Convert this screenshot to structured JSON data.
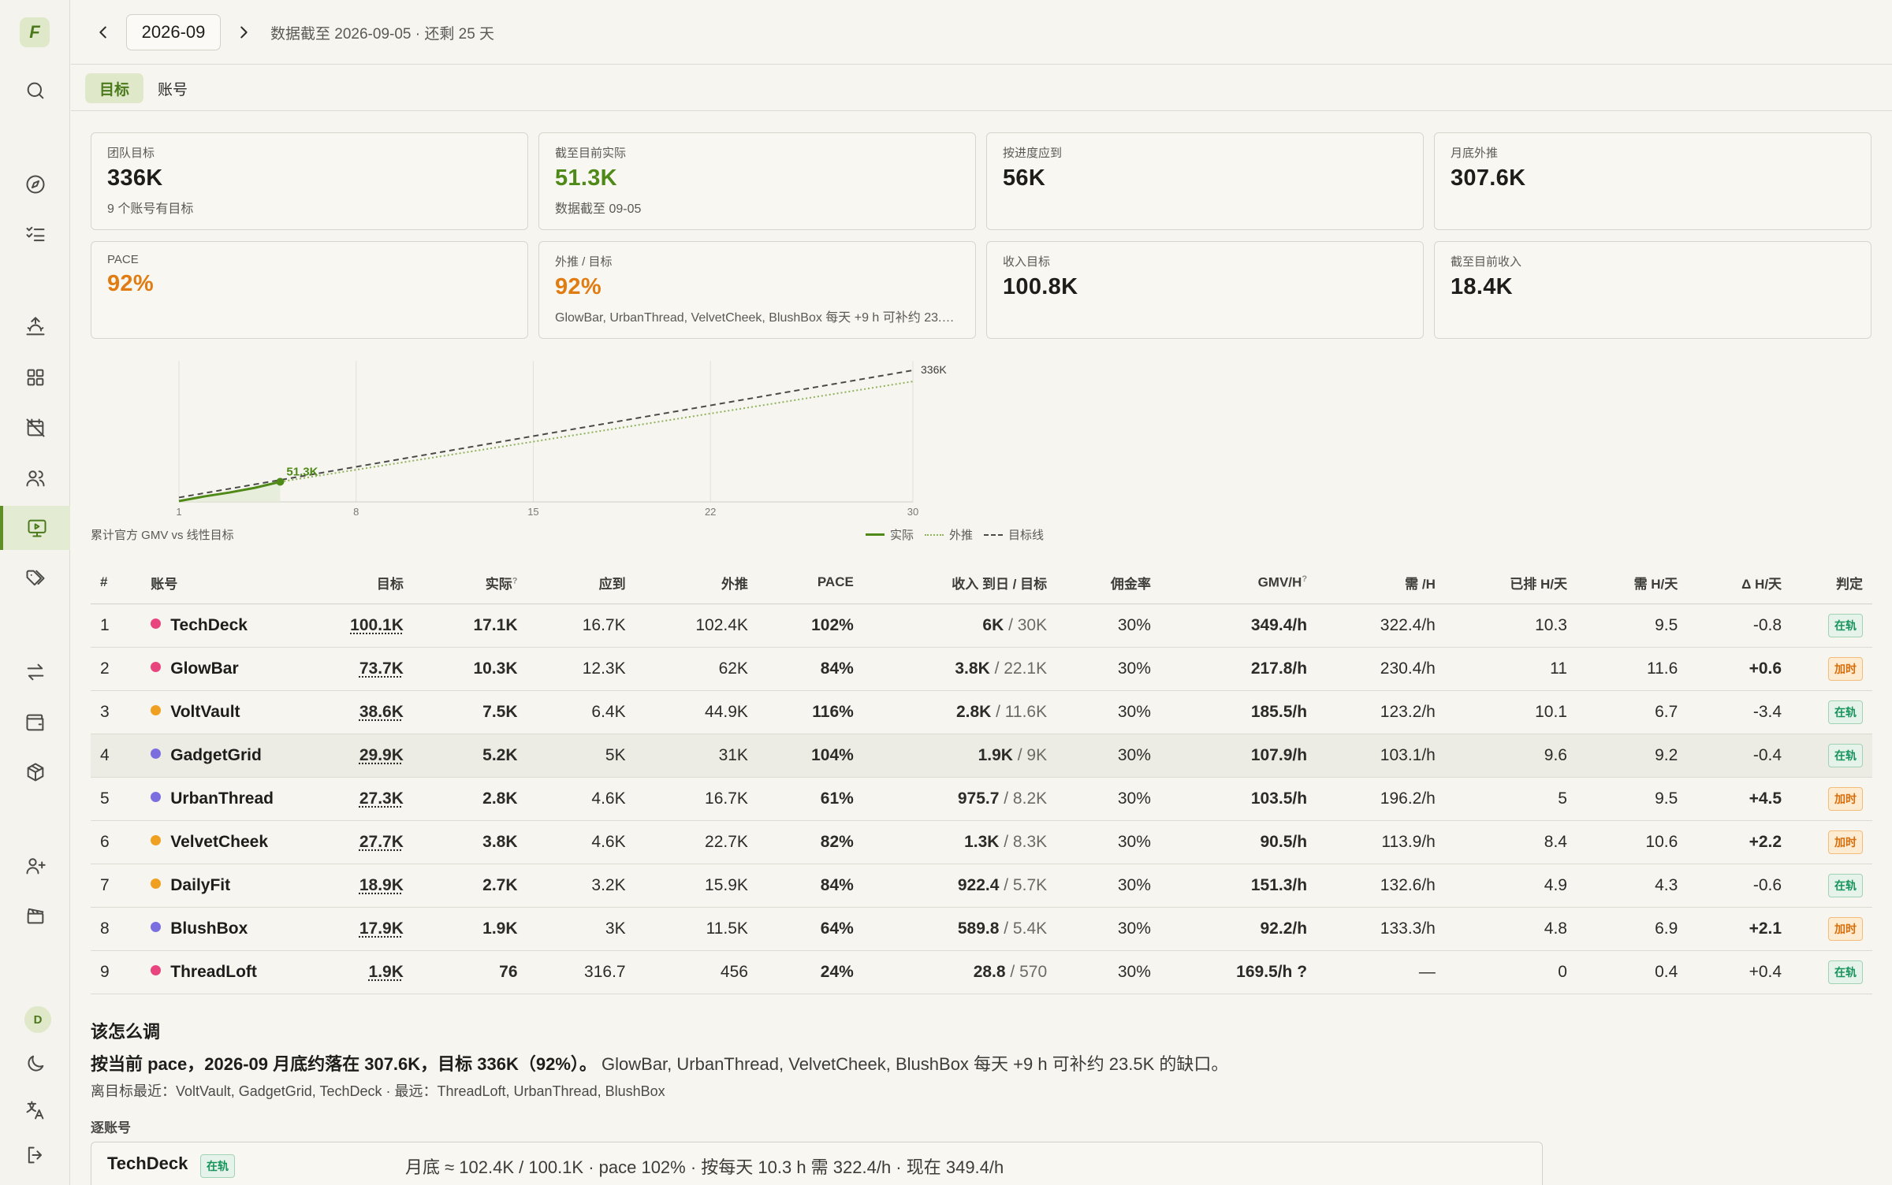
{
  "app": {
    "logo": "F",
    "user_initial": "D"
  },
  "sidebar": {
    "items": [
      {
        "icon": "search-icon",
        "name": "nav-search"
      },
      {
        "icon": "compass-icon",
        "name": "nav-explore"
      },
      {
        "icon": "list-checks-icon",
        "name": "nav-tasks"
      },
      {
        "icon": "sunrise-icon",
        "name": "nav-daily"
      },
      {
        "icon": "grid-icon",
        "name": "nav-dashboard"
      },
      {
        "icon": "calendar-off-icon",
        "name": "nav-schedule"
      },
      {
        "icon": "users-icon",
        "name": "nav-team"
      },
      {
        "icon": "monitor-play-icon",
        "name": "nav-live",
        "active": true
      },
      {
        "icon": "tags-icon",
        "name": "nav-tags"
      },
      {
        "icon": "arrows-exchange-icon",
        "name": "nav-transfer"
      },
      {
        "icon": "wallet-icon",
        "name": "nav-wallet"
      },
      {
        "icon": "box-icon",
        "name": "nav-products"
      },
      {
        "icon": "user-plus-icon",
        "name": "nav-invite"
      },
      {
        "icon": "clapperboard-icon",
        "name": "nav-media"
      },
      {
        "icon": "moon-icon",
        "name": "nav-theme"
      },
      {
        "icon": "translate-icon",
        "name": "nav-language"
      },
      {
        "icon": "logout-icon",
        "name": "nav-logout"
      }
    ]
  },
  "topbar": {
    "month": "2026-09",
    "data_note": "数据截至 2026-09-05 · 还剩 25 天"
  },
  "tabs": [
    {
      "label": "目标",
      "active": true
    },
    {
      "label": "账号",
      "active": false
    }
  ],
  "stats": [
    {
      "label": "团队目标",
      "value": "336K",
      "sub": "9 个账号有目标",
      "color": "default"
    },
    {
      "label": "截至目前实际",
      "value": "51.3K",
      "sub": "数据截至 09-05",
      "color": "green"
    },
    {
      "label": "按进度应到",
      "value": "56K",
      "sub": "",
      "color": "default"
    },
    {
      "label": "月底外推",
      "value": "307.6K",
      "sub": "",
      "color": "default"
    },
    {
      "label": "PACE",
      "value": "92%",
      "sub": "",
      "color": "orange"
    },
    {
      "label": "外推 / 目标",
      "value": "92%",
      "sub": "GlowBar, UrbanThread, VelvetCheek, BlushBox 每天 +9 h 可补约 23.5K 的缺口。",
      "color": "orange"
    },
    {
      "label": "收入目标",
      "value": "100.8K",
      "sub": "",
      "color": "default"
    },
    {
      "label": "截至目前收入",
      "value": "18.4K",
      "sub": "",
      "color": "default"
    }
  ],
  "chart_data": {
    "type": "line",
    "caption": "累计官方 GMV vs 线性目标",
    "x_ticks": [
      "1",
      "8",
      "15",
      "22",
      "30"
    ],
    "xlim": [
      1,
      30
    ],
    "ylim": [
      0,
      336
    ],
    "actual_label": "51.3K",
    "target_end_label": "336K",
    "series": [
      {
        "name": "实际",
        "style": "solid",
        "color": "#4f8a18",
        "x": [
          1,
          2,
          3,
          4,
          5
        ],
        "y": [
          2,
          14,
          24,
          36,
          51.3
        ]
      },
      {
        "name": "外推",
        "style": "dotted",
        "color": "#8fb35a",
        "x": [
          5,
          30
        ],
        "y": [
          51.3,
          307.6
        ]
      },
      {
        "name": "目标线",
        "style": "dashed",
        "color": "#4a4a46",
        "x": [
          1,
          30
        ],
        "y": [
          11.2,
          336
        ]
      }
    ],
    "legend": [
      "实际",
      "外推",
      "目标线"
    ]
  },
  "table": {
    "headers": [
      "#",
      "账号",
      "目标",
      "实际",
      "应到",
      "外推",
      "PACE",
      "收入 到日 / 目标",
      "佣金率",
      "GMV/H",
      "需 /H",
      "已排 H/天",
      "需 H/天",
      "Δ H/天",
      "判定"
    ],
    "rows": [
      {
        "n": "1",
        "name": "TechDeck",
        "dot": "#e8457f",
        "target": "100.1K",
        "actual": "17.1K",
        "due": "16.7K",
        "proj": "102.4K",
        "pace": "102%",
        "pace_c": "pg",
        "inc": "6K",
        "inc_t": " / 30K",
        "rate": "30%",
        "gmvh": "349.4/h",
        "gmvh_c": "pg",
        "needh": "322.4/h",
        "sched": "10.3",
        "needday": "9.5",
        "delta": "-0.8",
        "delta_c": "",
        "verdict": "在轨",
        "verdict_c": "ok"
      },
      {
        "n": "2",
        "name": "GlowBar",
        "dot": "#e8457f",
        "target": "73.7K",
        "actual": "10.3K",
        "due": "12.3K",
        "proj": "62K",
        "pace": "84%",
        "pace_c": "pr",
        "inc": "3.8K",
        "inc_t": " / 22.1K",
        "rate": "30%",
        "gmvh": "217.8/h",
        "gmvh_c": "pg",
        "needh": "230.4/h",
        "sched": "11",
        "needday": "11.6",
        "delta": "+0.6",
        "delta_c": "do",
        "verdict": "加时",
        "verdict_c": "add"
      },
      {
        "n": "3",
        "name": "VoltVault",
        "dot": "#f0a020",
        "target": "38.6K",
        "actual": "7.5K",
        "due": "6.4K",
        "proj": "44.9K",
        "pace": "116%",
        "pace_c": "pg",
        "inc": "2.8K",
        "inc_t": " / 11.6K",
        "rate": "30%",
        "gmvh": "185.5/h",
        "gmvh_c": "pg",
        "needh": "123.2/h",
        "sched": "10.1",
        "needday": "6.7",
        "delta": "-3.4",
        "delta_c": "",
        "verdict": "在轨",
        "verdict_c": "ok"
      },
      {
        "n": "4",
        "name": "GadgetGrid",
        "dot": "#7b6fe0",
        "target": "29.9K",
        "actual": "5.2K",
        "due": "5K",
        "proj": "31K",
        "pace": "104%",
        "pace_c": "pg",
        "inc": "1.9K",
        "inc_t": " / 9K",
        "rate": "30%",
        "gmvh": "107.9/h",
        "gmvh_c": "pg",
        "needh": "103.1/h",
        "sched": "9.6",
        "needday": "9.2",
        "delta": "-0.4",
        "delta_c": "",
        "verdict": "在轨",
        "verdict_c": "ok",
        "hl": true
      },
      {
        "n": "5",
        "name": "UrbanThread",
        "dot": "#7b6fe0",
        "target": "27.3K",
        "actual": "2.8K",
        "due": "4.6K",
        "proj": "16.7K",
        "pace": "61%",
        "pace_c": "pr",
        "inc": "975.7",
        "inc_t": " / 8.2K",
        "rate": "30%",
        "gmvh": "103.5/h",
        "gmvh_c": "pg",
        "needh": "196.2/h",
        "sched": "5",
        "needday": "9.5",
        "delta": "+4.5",
        "delta_c": "do",
        "verdict": "加时",
        "verdict_c": "add"
      },
      {
        "n": "6",
        "name": "VelvetCheek",
        "dot": "#f0a020",
        "target": "27.7K",
        "actual": "3.8K",
        "due": "4.6K",
        "proj": "22.7K",
        "pace": "82%",
        "pace_c": "pr",
        "inc": "1.3K",
        "inc_t": " / 8.3K",
        "rate": "30%",
        "gmvh": "90.5/h",
        "gmvh_c": "go",
        "needh": "113.9/h",
        "sched": "8.4",
        "needday": "10.6",
        "delta": "+2.2",
        "delta_c": "do",
        "verdict": "加时",
        "verdict_c": "add"
      },
      {
        "n": "7",
        "name": "DailyFit",
        "dot": "#f0a020",
        "target": "18.9K",
        "actual": "2.7K",
        "due": "3.2K",
        "proj": "15.9K",
        "pace": "84%",
        "pace_c": "pr",
        "inc": "922.4",
        "inc_t": " / 5.7K",
        "rate": "30%",
        "gmvh": "151.3/h",
        "gmvh_c": "pg",
        "needh": "132.6/h",
        "sched": "4.9",
        "needday": "4.3",
        "delta": "-0.6",
        "delta_c": "",
        "verdict": "在轨",
        "verdict_c": "ok"
      },
      {
        "n": "8",
        "name": "BlushBox",
        "dot": "#7b6fe0",
        "target": "17.9K",
        "actual": "1.9K",
        "due": "3K",
        "proj": "11.5K",
        "pace": "64%",
        "pace_c": "pr",
        "inc": "589.8",
        "inc_t": " / 5.4K",
        "rate": "30%",
        "gmvh": "92.2/h",
        "gmvh_c": "go",
        "needh": "133.3/h",
        "sched": "4.8",
        "needday": "6.9",
        "delta": "+2.1",
        "delta_c": "do",
        "verdict": "加时",
        "verdict_c": "add"
      },
      {
        "n": "9",
        "name": "ThreadLoft",
        "dot": "#e8457f",
        "target": "1.9K",
        "actual": "76",
        "due": "316.7",
        "proj": "456",
        "pace": "24%",
        "pace_c": "pr",
        "inc": "28.8",
        "inc_t": " / 570",
        "rate": "30%",
        "gmvh": "169.5/h ?",
        "gmvh_c": "pg",
        "needh": "—",
        "sched": "0",
        "needday": "0.4",
        "delta": "+0.4",
        "delta_c": "",
        "verdict": "在轨",
        "verdict_c": "ok"
      }
    ]
  },
  "advice": {
    "title": "该怎么调",
    "bold": "按当前 pace，2026-09 月底约落在 307.6K，目标 336K（92%）。",
    "rest": " GlowBar, UrbanThread, VelvetCheek, BlushBox 每天 +9 h 可补约 23.5K 的缺口。",
    "near": "离目标最近：VoltVault, GadgetGrid, TechDeck · 最远：ThreadLoft, UrbanThread, BlushBox",
    "per_title": "逐账号",
    "per_first": {
      "name": "TechDeck",
      "badge": "在轨",
      "desc": "月底 ≈ 102.4K / 100.1K · pace 102% · 按每天 10.3 h 需 322.4/h · 现在 349.4/h"
    }
  }
}
